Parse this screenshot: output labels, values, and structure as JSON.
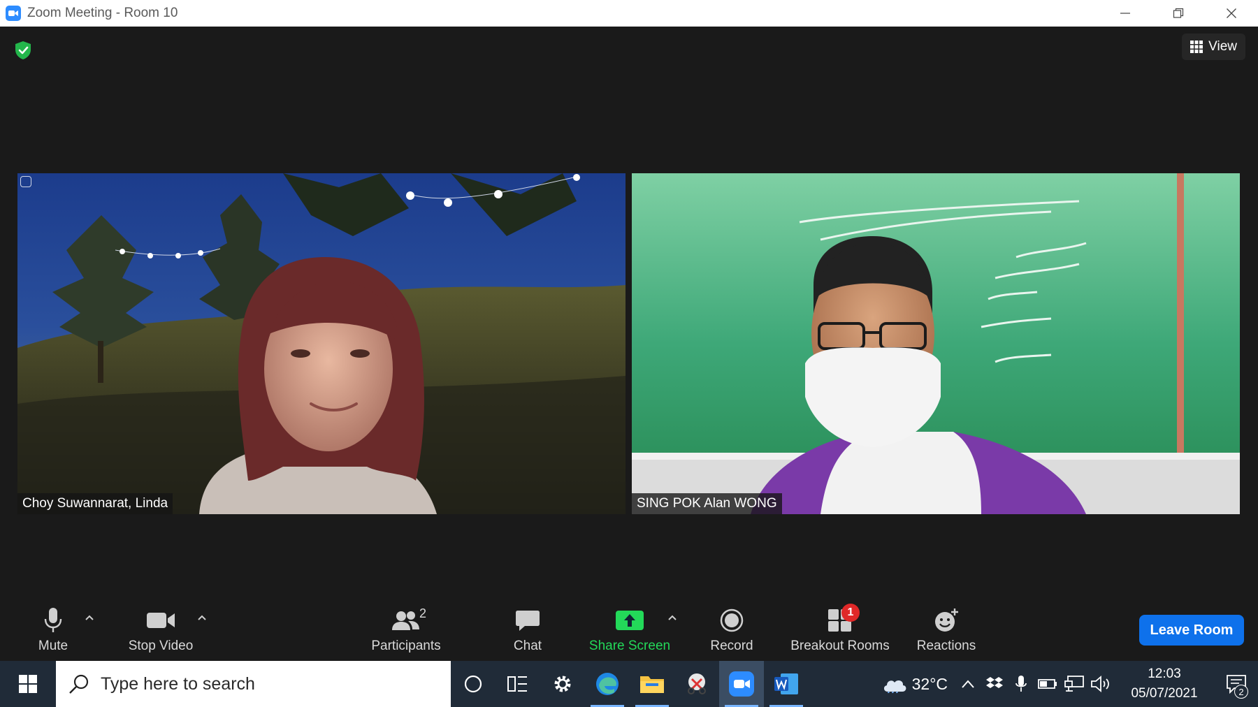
{
  "window": {
    "title": "Zoom Meeting - Room 10"
  },
  "meeting": {
    "view_label": "View",
    "participants": [
      {
        "name": "Choy Suwannarat, Linda"
      },
      {
        "name": "SING POK Alan WONG"
      }
    ]
  },
  "toolbar": {
    "mute_label": "Mute",
    "stop_video_label": "Stop Video",
    "participants_label": "Participants",
    "participants_count": "2",
    "chat_label": "Chat",
    "share_screen_label": "Share Screen",
    "record_label": "Record",
    "breakout_rooms_label": "Breakout Rooms",
    "breakout_badge": "1",
    "reactions_label": "Reactions",
    "leave_label": "Leave Room"
  },
  "taskbar": {
    "search_placeholder": "Type here to search",
    "temperature": "32°C",
    "time": "12:03",
    "date": "05/07/2021",
    "notification_count": "2"
  },
  "colors": {
    "leave_button": "#0e71eb",
    "share_screen": "#23d959",
    "badge": "#e02828"
  }
}
